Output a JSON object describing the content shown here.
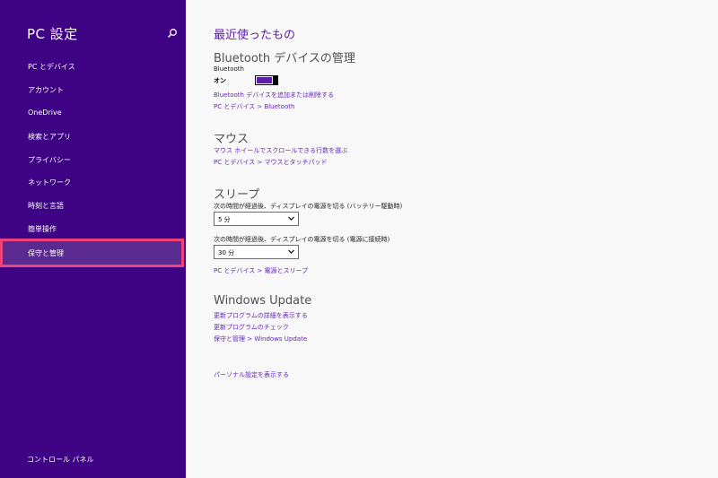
{
  "sidebar": {
    "title": "PC 設定",
    "items": [
      {
        "label": "PC とデバイス"
      },
      {
        "label": "アカウント"
      },
      {
        "label": "OneDrive"
      },
      {
        "label": "検索とアプリ"
      },
      {
        "label": "プライバシー"
      },
      {
        "label": "ネットワーク"
      },
      {
        "label": "時刻と言語"
      },
      {
        "label": "簡単操作"
      },
      {
        "label": "保守と管理",
        "selected": true
      }
    ],
    "control_panel": "コントロール パネル",
    "search_icon": "search-icon"
  },
  "main": {
    "title": "最近使ったもの",
    "bluetooth": {
      "heading": "Bluetooth デバイスの管理",
      "label": "Bluetooth",
      "state": "オン",
      "link_add": "Bluetooth デバイスを追加または削除する",
      "link_path": "PC とデバイス > Bluetooth"
    },
    "mouse": {
      "heading": "マウス",
      "link_scroll": "マウス ホイールでスクロールできる行数を選ぶ",
      "link_path": "PC とデバイス > マウスとタッチパッド"
    },
    "sleep": {
      "heading": "スリープ",
      "battery_label": "次の時間が経過後、ディスプレイの電源を切る (バッテリー駆動時)",
      "battery_value": "5 分",
      "plugged_label": "次の時間が経過後、ディスプレイの電源を切る (電源に接続時)",
      "plugged_value": "30 分",
      "link_path": "PC とデバイス > 電源とスリープ"
    },
    "windows_update": {
      "heading": "Windows Update",
      "link_details": "更新プログラムの詳細を表示する",
      "link_check": "更新プログラムのチェック",
      "link_path": "保守と管理 > Windows Update"
    },
    "personal_link": "パーソナル設定を表示する"
  },
  "colors": {
    "sidebar_bg": "#3e0284",
    "accent": "#5c1ea6",
    "selection_outline": "#f0437e"
  }
}
